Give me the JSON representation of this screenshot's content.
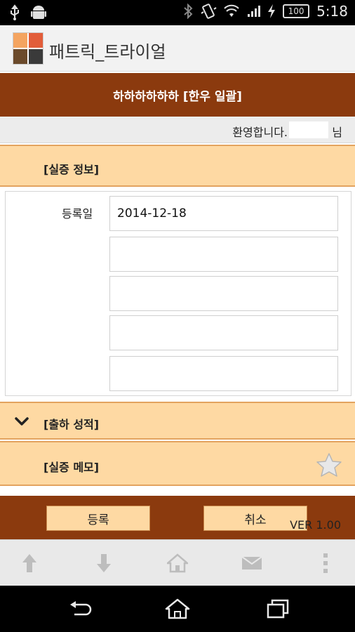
{
  "status_bar": {
    "time": "5:18",
    "battery": "100",
    "icons": [
      "usb-icon",
      "android-icon",
      "bluetooth-icon",
      "vibrate-icon",
      "wifi-icon",
      "signal-icon",
      "charging-icon"
    ]
  },
  "app": {
    "title": "패트릭_트라이얼",
    "icon": "app-icon"
  },
  "header": {
    "title": "하하하하하하 [한우 일괄]"
  },
  "welcome": {
    "text": "환영합니다.",
    "user_name": "",
    "suffix": "님"
  },
  "sections": {
    "info_label": "[실증 정보]",
    "shipping_label": "[출하 성적]",
    "memo_label": "[실증 메모]"
  },
  "form": {
    "registration_date_label": "등록일",
    "registration_date_value": "2014-12-18",
    "extra_fields": [
      "",
      "",
      "",
      ""
    ]
  },
  "actions": {
    "register_label": "등록",
    "cancel_label": "취소",
    "version": "VER 1.00"
  },
  "toolbar": {
    "items": [
      "upload-icon",
      "download-icon",
      "home-icon",
      "mail-icon",
      "overflow-menu-icon"
    ]
  },
  "navbar": {
    "items": [
      "back-icon",
      "home-icon",
      "recent-apps-icon"
    ]
  },
  "colors": {
    "brand_brown": "#8b3a0e",
    "section_peach": "#fed9a3",
    "section_border": "#e3a35f"
  }
}
